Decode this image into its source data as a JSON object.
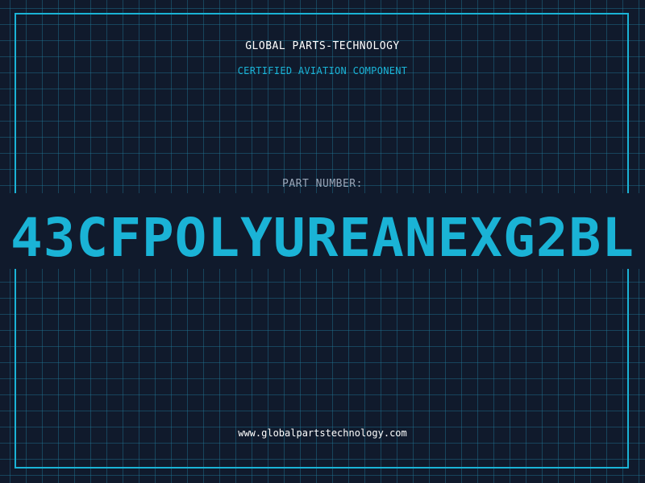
{
  "header": {
    "company": "GLOBAL PARTS-TECHNOLOGY",
    "subtitle": "CERTIFIED AVIATION COMPONENT"
  },
  "part": {
    "label": "PART NUMBER:",
    "number": "43CFPOLYUREANEXG2BL"
  },
  "footer": {
    "website": "www.globalpartstechnology.com"
  },
  "colors": {
    "background": "#101a2c",
    "accent": "#1ab3d6",
    "grid": "#207896"
  }
}
